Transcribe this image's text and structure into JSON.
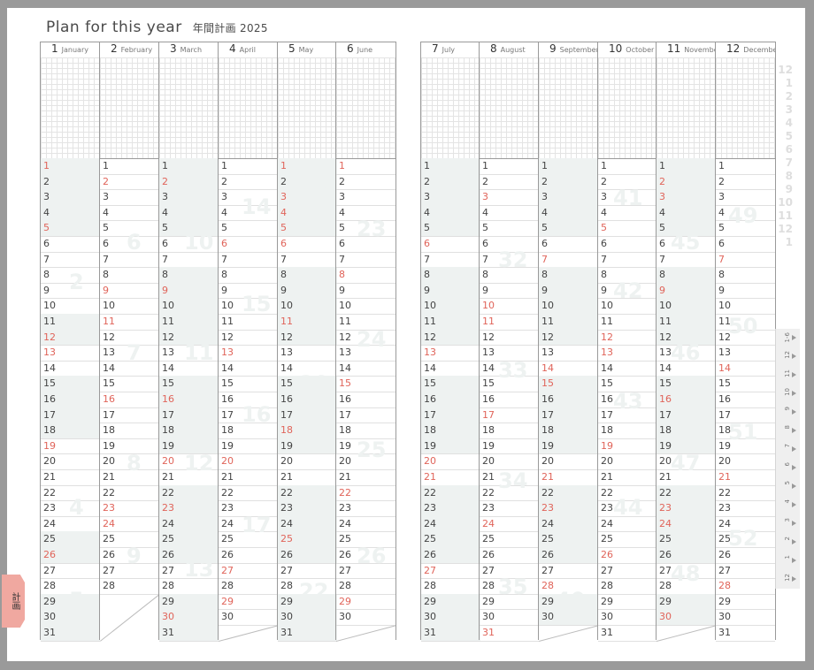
{
  "title": {
    "en": "Plan for this year",
    "jp": "年間計画 2025"
  },
  "colors": {
    "weekend": "#e0645a",
    "shade": "#eef2f1",
    "line": "#9a9a9a",
    "tab_accent": "#f0a8a0"
  },
  "side_tab": {
    "label": "計画"
  },
  "months": [
    {
      "num": "1",
      "name": "January",
      "days": 31,
      "red": [
        1,
        5,
        12,
        13,
        19,
        26
      ],
      "shade": [
        1,
        2,
        3,
        4,
        5,
        11,
        12,
        13,
        14,
        15,
        16,
        17,
        18,
        25,
        26,
        27,
        28,
        29,
        30,
        31
      ]
    },
    {
      "num": "2",
      "name": "February",
      "days": 28,
      "red": [
        2,
        9,
        11,
        16,
        23,
        24
      ],
      "shade": [
        1,
        2,
        3,
        4,
        5,
        6,
        7,
        8,
        9,
        10,
        17,
        18,
        19,
        20,
        21,
        22,
        23
      ]
    },
    {
      "num": "3",
      "name": "March",
      "days": 31,
      "red": [
        2,
        9,
        16,
        20,
        23,
        30
      ],
      "shade": [
        1,
        2,
        3,
        4,
        5,
        6,
        7,
        8,
        9,
        10,
        11,
        12,
        13,
        14,
        15,
        16,
        17,
        18,
        19,
        20,
        21,
        22,
        23,
        24,
        25,
        26,
        27,
        28,
        29,
        30,
        31
      ]
    },
    {
      "num": "4",
      "name": "April",
      "days": 30,
      "red": [
        6,
        13,
        20,
        27,
        29
      ],
      "shade": [
        1,
        2,
        3,
        4,
        5,
        6,
        7,
        8,
        9,
        10,
        11,
        12,
        13,
        14,
        15,
        16,
        17,
        18,
        19,
        20,
        21,
        22,
        23,
        24,
        25,
        26,
        27,
        28,
        29,
        30
      ]
    },
    {
      "num": "5",
      "name": "May",
      "days": 31,
      "red": [
        1,
        3,
        4,
        5,
        6,
        11,
        18,
        25
      ],
      "shade": [
        1,
        2,
        3,
        4,
        5,
        6,
        7,
        8,
        9,
        10,
        11,
        12,
        13,
        14,
        15,
        16,
        17,
        18,
        19,
        20,
        21,
        22,
        23,
        24,
        25,
        26,
        27,
        28,
        29,
        30,
        31
      ]
    },
    {
      "num": "6",
      "name": "June",
      "days": 30,
      "red": [
        1,
        8,
        15,
        22,
        29
      ],
      "shade": [
        1,
        2,
        3,
        4,
        5,
        6,
        7,
        8,
        9,
        10,
        11,
        12,
        13,
        14,
        15,
        16,
        17,
        18,
        19,
        20,
        21,
        22,
        23,
        24,
        25,
        26,
        27,
        28,
        29,
        30
      ]
    },
    {
      "num": "7",
      "name": "July",
      "days": 31,
      "red": [
        6,
        13,
        20,
        21,
        27
      ],
      "shade": [
        1,
        2,
        3,
        4,
        5,
        6,
        7,
        8,
        9,
        10,
        11,
        12,
        13,
        14,
        15,
        16,
        17,
        18,
        19,
        20,
        21,
        22,
        23,
        24,
        25,
        26,
        27,
        28,
        29,
        30,
        31
      ]
    },
    {
      "num": "8",
      "name": "August",
      "days": 31,
      "red": [
        3,
        10,
        11,
        17,
        24,
        31
      ],
      "shade": [
        1,
        2,
        3,
        4,
        5,
        6,
        7,
        8,
        9,
        10,
        11,
        12,
        13,
        14,
        15,
        16,
        17,
        18,
        19,
        20,
        21,
        22,
        23,
        24,
        25,
        26,
        27,
        28,
        29,
        30,
        31
      ]
    },
    {
      "num": "9",
      "name": "September",
      "days": 30,
      "red": [
        7,
        14,
        15,
        21,
        23,
        28
      ],
      "shade": [
        1,
        2,
        3,
        4,
        5,
        6,
        7,
        8,
        9,
        10,
        11,
        12,
        13,
        14,
        15,
        16,
        17,
        18,
        19,
        20,
        21,
        22,
        23,
        24,
        25,
        26,
        27,
        28,
        29,
        30
      ]
    },
    {
      "num": "10",
      "name": "October",
      "days": 31,
      "red": [
        5,
        12,
        13,
        19,
        26
      ],
      "shade": [
        1,
        2,
        3,
        4,
        5,
        6,
        7,
        8,
        9,
        10,
        11,
        12,
        13,
        14,
        15,
        16,
        17,
        18,
        19,
        20,
        21,
        22,
        23,
        24,
        25,
        26,
        27,
        28,
        29,
        30,
        31
      ]
    },
    {
      "num": "11",
      "name": "November",
      "days": 30,
      "red": [
        2,
        3,
        9,
        16,
        23,
        24,
        30
      ],
      "shade": [
        1,
        2,
        3,
        4,
        5,
        6,
        7,
        8,
        9,
        10,
        11,
        12,
        13,
        14,
        15,
        16,
        17,
        18,
        19,
        20,
        21,
        22,
        23,
        24,
        25,
        26,
        27,
        28,
        29,
        30
      ]
    },
    {
      "num": "12",
      "name": "December",
      "days": 31,
      "red": [
        7,
        14,
        21,
        28
      ],
      "shade": [
        1,
        2,
        3,
        4,
        5,
        6,
        7,
        8,
        9,
        10,
        11,
        12,
        13,
        14,
        15,
        16,
        17,
        18,
        19,
        20,
        21,
        22,
        23,
        24,
        25,
        26,
        27,
        28,
        29,
        30,
        31
      ]
    }
  ],
  "right_index": [
    "12",
    "1",
    "2",
    "3",
    "4",
    "5",
    "6",
    "7",
    "8",
    "9",
    "10",
    "11",
    "12",
    "1"
  ],
  "tabs": [
    "12",
    "1",
    "2",
    "3",
    "4",
    "5",
    "6",
    "7",
    "8",
    "9",
    "10",
    "11",
    "12",
    "1-6"
  ],
  "week_numbers": [
    "1",
    "2",
    "3",
    "4",
    "5",
    "6",
    "7",
    "8",
    "9",
    "10",
    "11",
    "12",
    "13",
    "14",
    "15",
    "16",
    "17",
    "18",
    "19",
    "20",
    "21",
    "22",
    "23",
    "24",
    "25",
    "26",
    "27",
    "28",
    "29",
    "30",
    "31",
    "32",
    "33",
    "34",
    "35",
    "36",
    "37",
    "38",
    "39",
    "40",
    "41",
    "42",
    "43",
    "44",
    "45",
    "46",
    "47",
    "48",
    "49",
    "50",
    "51",
    "52"
  ]
}
